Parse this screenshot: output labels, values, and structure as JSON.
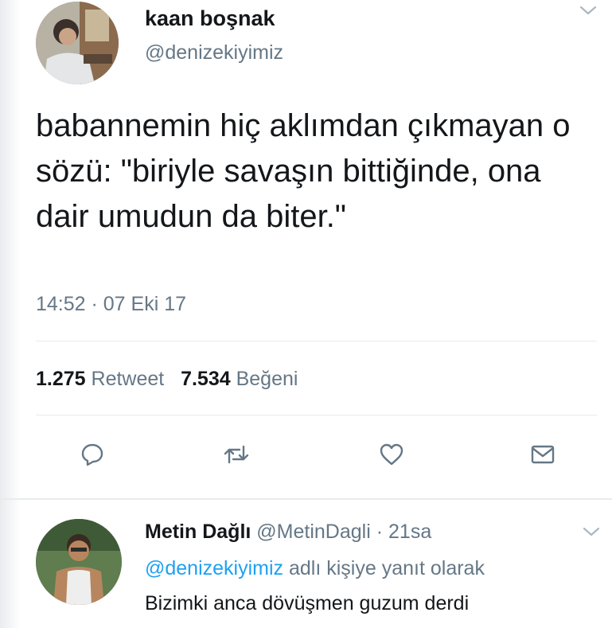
{
  "tweet": {
    "author_name": "kaan boşnak",
    "author_handle": "@denizekiyimiz",
    "text": "babannemin hiç aklımdan çıkmayan o sözü: \"biriyle savaşın bittiğinde, ona dair umudun da biter.\"",
    "timestamp": "14:52 · 07 Eki 17",
    "retweet_count": "1.275",
    "retweet_label": "Retweet",
    "like_count": "7.534",
    "like_label": "Beğeni"
  },
  "actions": [
    {
      "name": "reply-icon"
    },
    {
      "name": "retweet-icon"
    },
    {
      "name": "like-icon"
    },
    {
      "name": "direct-message-icon"
    }
  ],
  "reply": {
    "author_name": "Metin Dağlı",
    "author_handle": "@MetinDagli",
    "separator": "·",
    "time": "21sa",
    "reply_to_mention": "@denizekiyimiz",
    "reply_to_suffix": "adlı kişiye yanıt olarak",
    "text": "Bizimki anca dövüşmen guzum derdi"
  },
  "colors": {
    "text_primary": "#14171a",
    "text_secondary": "#657786",
    "link": "#1da1f2",
    "divider": "#e6ecf0"
  }
}
